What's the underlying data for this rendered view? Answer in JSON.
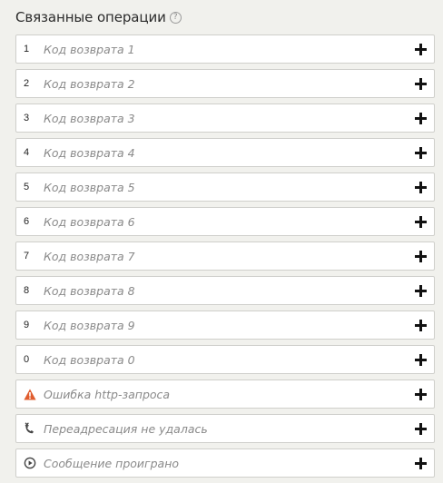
{
  "header": {
    "title": "Связанные операции",
    "help_glyph": "?"
  },
  "colors": {
    "warning": "#e05d2e",
    "icon_gray": "#444444",
    "label_gray": "#8a8a8a",
    "background": "#f1f1ed"
  },
  "rows": [
    {
      "key": "1",
      "label": "Код возврата 1",
      "icon": "add-icon"
    },
    {
      "key": "2",
      "label": "Код возврата 2",
      "icon": "add-icon"
    },
    {
      "key": "3",
      "label": "Код возврата 3",
      "icon": "add-icon"
    },
    {
      "key": "4",
      "label": "Код возврата 4",
      "icon": "add-icon"
    },
    {
      "key": "5",
      "label": "Код возврата 5",
      "icon": "add-icon"
    },
    {
      "key": "6",
      "label": "Код возврата 6",
      "icon": "add-icon"
    },
    {
      "key": "7",
      "label": "Код возврата 7",
      "icon": "add-icon"
    },
    {
      "key": "8",
      "label": "Код возврата 8",
      "icon": "add-icon"
    },
    {
      "key": "9",
      "label": "Код возврата 9",
      "icon": "add-icon"
    },
    {
      "key": "0",
      "label": "Код возврата 0",
      "icon": "add-icon"
    },
    {
      "row_icon": "warning-triangle-icon",
      "label": "Ошибка http-запроса",
      "icon": "add-icon"
    },
    {
      "row_icon": "call-forward-failed-icon",
      "label": "Переадресация не удалась",
      "icon": "add-icon"
    },
    {
      "row_icon": "playback-finished-icon",
      "label": "Сообщение проиграно",
      "icon": "add-icon"
    }
  ]
}
